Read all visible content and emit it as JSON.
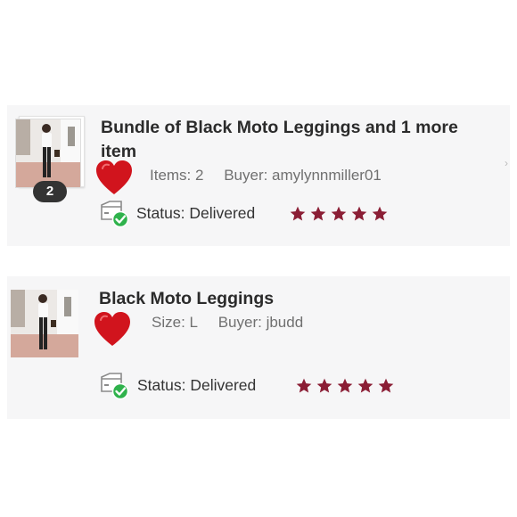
{
  "orders": [
    {
      "title": "Bundle of Black Moto Leggings and 1 more item",
      "title_line1": "Bundle of Black Moto Leggings and 1 more",
      "title_line2": "item",
      "count_badge": "2",
      "meta_left": "Items: 2",
      "meta_right": "Buyer: amylynnmiller01",
      "status": "Status:  Delivered",
      "rating": 5,
      "liked": true
    },
    {
      "title": "Black Moto Leggings",
      "meta_left": "Size: L",
      "meta_right": "Buyer: jbudd",
      "status": "Status:  Delivered",
      "rating": 5,
      "liked": true
    }
  ],
  "colors": {
    "star": "#8b1e35",
    "heart": "#d1141d",
    "status_check": "#2fb24c",
    "card_bg": "#f6f6f7"
  },
  "icons": {
    "heart": "heart-icon",
    "status": "delivered-box-icon",
    "star": "star-icon"
  }
}
